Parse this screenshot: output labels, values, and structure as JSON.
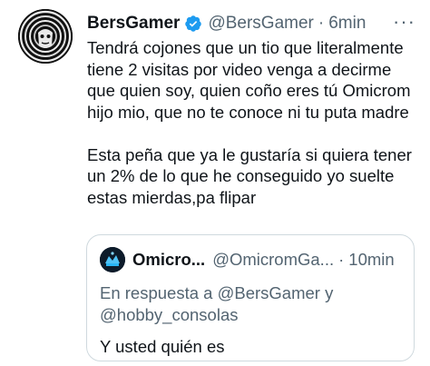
{
  "tweet": {
    "author_name": "BersGamer",
    "author_handle": "@BersGamer",
    "separator": "·",
    "time": "6min",
    "more": "···",
    "text": "Tendrá cojones que un tio que literalmente\ntiene 2 visitas por video venga a decirme\nque quien soy, quien coño eres tú Omicrom\nhijo mio, que no te conoce ni tu puta madre\n\nEsta peña que ya le gustaría si quiera tener\nun 2% de lo que he conseguido yo suelte\nestas mierdas,pa flipar"
  },
  "quote": {
    "author_name": "Omicro...",
    "author_handle": "@OmicromGa...",
    "separator": "·",
    "time": "10min",
    "reply_prefix": "En respuesta a",
    "reply_mention_1": "@BersGamer",
    "reply_and": "y",
    "reply_mention_2": "@hobby_consolas",
    "text": "Y usted quién es"
  },
  "colors": {
    "text": "#0f1419",
    "secondary": "#536471",
    "verified": "#1d9bf0",
    "border": "#cfd9de"
  },
  "icons": {
    "verified": "verified-badge-icon",
    "more": "more-options-icon"
  }
}
